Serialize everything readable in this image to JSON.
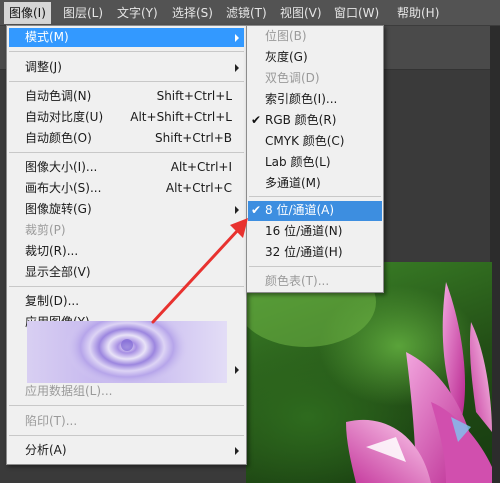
{
  "menubar": {
    "items": [
      {
        "label": "图像(I)"
      },
      {
        "label": "图层(L)"
      },
      {
        "label": "文字(Y)"
      },
      {
        "label": "选择(S)"
      },
      {
        "label": "滤镜(T)"
      },
      {
        "label": "视图(V)"
      },
      {
        "label": "窗口(W)"
      },
      {
        "label": "帮助(H)"
      }
    ]
  },
  "image_menu": {
    "items": [
      {
        "label": "模式(M)",
        "shortcut": "",
        "has_submenu": true,
        "disabled": false
      },
      {
        "label": "调整(J)",
        "shortcut": "",
        "has_submenu": true,
        "disabled": false
      },
      {
        "label": "自动色调(N)",
        "shortcut": "Shift+Ctrl+L",
        "disabled": false
      },
      {
        "label": "自动对比度(U)",
        "shortcut": "Alt+Shift+Ctrl+L",
        "disabled": false
      },
      {
        "label": "自动颜色(O)",
        "shortcut": "Shift+Ctrl+B",
        "disabled": false
      },
      {
        "label": "图像大小(I)...",
        "shortcut": "Alt+Ctrl+I",
        "disabled": false
      },
      {
        "label": "画布大小(S)...",
        "shortcut": "Alt+Ctrl+C",
        "disabled": false
      },
      {
        "label": "图像旋转(G)",
        "shortcut": "",
        "has_submenu": true,
        "disabled": false
      },
      {
        "label": "裁剪(P)",
        "shortcut": "",
        "disabled": true
      },
      {
        "label": "裁切(R)...",
        "shortcut": "",
        "disabled": false
      },
      {
        "label": "显示全部(V)",
        "shortcut": "",
        "disabled": false
      },
      {
        "label": "复制(D)...",
        "shortcut": "",
        "disabled": false
      },
      {
        "label": "应用图像(Y)...",
        "shortcut": "",
        "disabled": false
      },
      {
        "label": "应用数据组(L)...",
        "shortcut": "",
        "disabled": true
      },
      {
        "label": "陷印(T)...",
        "shortcut": "",
        "disabled": true
      },
      {
        "label": "分析(A)",
        "shortcut": "",
        "has_submenu": true,
        "disabled": false
      }
    ]
  },
  "mode_submenu": {
    "items": [
      {
        "label": "位图(B)",
        "disabled": true,
        "checked": false
      },
      {
        "label": "灰度(G)",
        "disabled": false,
        "checked": false
      },
      {
        "label": "双色调(D)",
        "disabled": true,
        "checked": false
      },
      {
        "label": "索引颜色(I)...",
        "disabled": false,
        "checked": false
      },
      {
        "label": "RGB 颜色(R)",
        "disabled": false,
        "checked": true
      },
      {
        "label": "CMYK 颜色(C)",
        "disabled": false,
        "checked": false
      },
      {
        "label": "Lab 颜色(L)",
        "disabled": false,
        "checked": false
      },
      {
        "label": "多通道(M)",
        "disabled": false,
        "checked": false
      },
      {
        "label": "8 位/通道(A)",
        "disabled": false,
        "checked": true
      },
      {
        "label": "16 位/通道(N)",
        "disabled": false,
        "checked": false
      },
      {
        "label": "32 位/通道(H)",
        "disabled": false,
        "checked": false
      },
      {
        "label": "颜色表(T)...",
        "disabled": true,
        "checked": false
      }
    ]
  },
  "colors": {
    "highlight": "#3399ff",
    "annotation_arrow": "#e8322f"
  },
  "check_glyph": "✔"
}
